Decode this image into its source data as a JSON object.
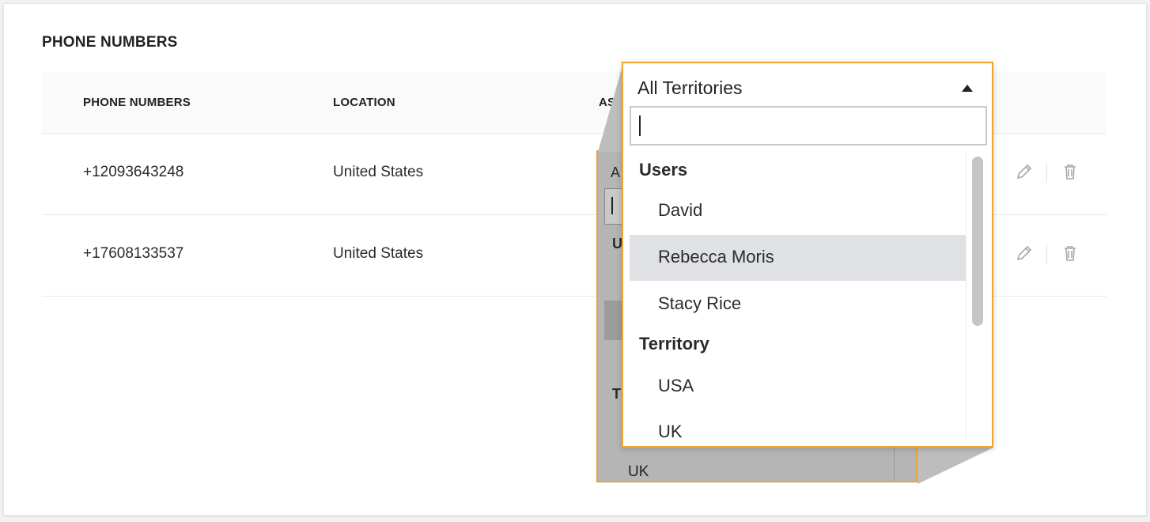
{
  "section": {
    "title": "PHONE NUMBERS"
  },
  "table": {
    "headers": [
      "PHONE NUMBERS",
      "LOCATION",
      "ASS"
    ],
    "rows": [
      {
        "phone": "+12093643248",
        "location": "United States"
      },
      {
        "phone": "+17608133537",
        "location": "United States"
      }
    ],
    "actions": {
      "edit_icon": "pencil-icon",
      "delete_icon": "trash-icon"
    }
  },
  "ghost_panel": {
    "letters": [
      "A",
      "U",
      "T"
    ],
    "last_item": "UK"
  },
  "dropdown": {
    "selected": "All Territories",
    "search_value": "",
    "groups": [
      {
        "label": "Users",
        "items": [
          "David",
          "Rebecca Moris",
          "Stacy Rice"
        ]
      },
      {
        "label": "Territory",
        "items": [
          "USA",
          "UK"
        ]
      }
    ],
    "highlighted_item": "Rebecca Moris"
  },
  "colors": {
    "accent_border": "#f0a52e",
    "selected_bg": "#dfe1e4",
    "ghost_bg": "#b5b5b5"
  }
}
